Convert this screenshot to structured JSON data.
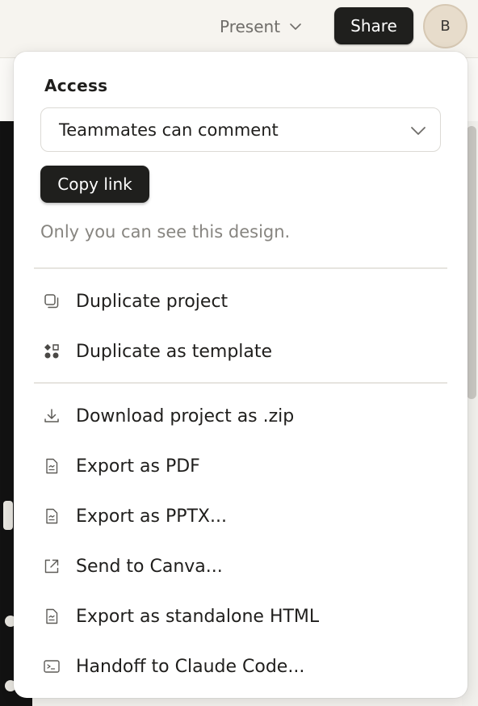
{
  "topbar": {
    "present_label": "Present",
    "share_label": "Share",
    "avatar_initial": "B"
  },
  "share_menu": {
    "access_heading": "Access",
    "access_select_value": "Teammates can comment",
    "copy_link_label": "Copy link",
    "visibility_note": "Only you can see this design.",
    "actions": [
      {
        "label": "Duplicate project",
        "icon": "duplicate-icon"
      },
      {
        "label": "Duplicate as template",
        "icon": "template-icon"
      },
      {
        "label": "Download project as .zip",
        "icon": "download-icon"
      },
      {
        "label": "Export as PDF",
        "icon": "document-icon"
      },
      {
        "label": "Export as PPTX...",
        "icon": "document-icon"
      },
      {
        "label": "Send to Canva...",
        "icon": "external-link-icon"
      },
      {
        "label": "Export as standalone HTML",
        "icon": "document-icon"
      },
      {
        "label": "Handoff to Claude Code...",
        "icon": "terminal-icon"
      }
    ]
  },
  "colors": {
    "accent_dark": "#1f1f1d",
    "muted_text": "#878580",
    "background": "#f4f2ee"
  }
}
